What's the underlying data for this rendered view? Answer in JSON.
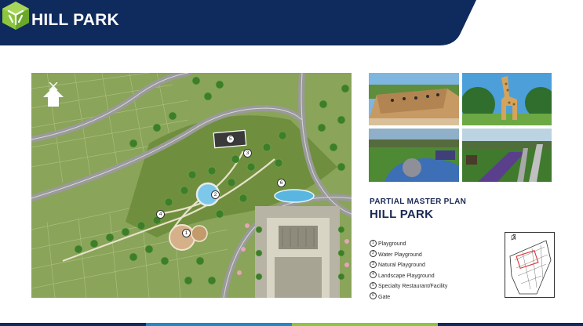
{
  "header": {
    "title": "HILL PARK",
    "bg_color": "#0f2a5c",
    "logo_icon": "green-cube-logo-icon"
  },
  "map": {
    "north_icon": "north-arrow-icon",
    "markers": [
      "1",
      "2",
      "3",
      "4",
      "5",
      "6"
    ]
  },
  "photos": [
    {
      "name": "playground-wall-photo"
    },
    {
      "name": "giraffe-sculpture-photo"
    },
    {
      "name": "playground-aerial-photo"
    },
    {
      "name": "slide-playground-photo"
    }
  ],
  "plan": {
    "subtitle": "PARTIAL MASTER PLAN",
    "title": "HILL PARK"
  },
  "legend": [
    {
      "num": "1",
      "label": "Playground"
    },
    {
      "num": "2",
      "label": "Water Playground"
    },
    {
      "num": "3",
      "label": "Natural Playground"
    },
    {
      "num": "4",
      "label": "Landscape Playground"
    },
    {
      "num": "5",
      "label": "Specialty Restaurant/Facility"
    },
    {
      "num": "6",
      "label": "Gate"
    }
  ],
  "footer_colors": [
    "#0f2a5c",
    "#1e88c8",
    "#8cc63f",
    "#0f2a5c"
  ]
}
